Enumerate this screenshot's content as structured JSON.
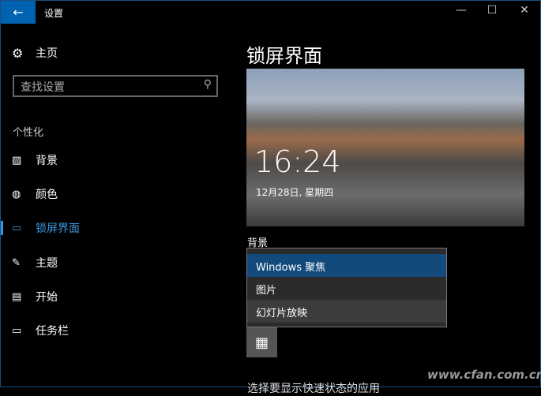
{
  "window": {
    "title": "设置",
    "back": "←",
    "minimize": "—",
    "maximize": "☐",
    "close": "✕"
  },
  "sidebar": {
    "home": "主页",
    "search_placeholder": "查找设置",
    "group": "个性化",
    "items": [
      {
        "label": "背景",
        "icon": "🖼"
      },
      {
        "label": "颜色",
        "icon": "🎨"
      },
      {
        "label": "锁屏界面",
        "icon": "▭"
      },
      {
        "label": "主题",
        "icon": "✎"
      },
      {
        "label": "开始",
        "icon": "▤"
      },
      {
        "label": "任务栏",
        "icon": "▭"
      }
    ]
  },
  "main": {
    "title": "锁屏界面",
    "preview_time": "16:24",
    "preview_date": "12月28日, 星期四",
    "background_label": "背景",
    "options": [
      "Windows 聚焦",
      "图片",
      "幻灯片放映"
    ],
    "below_text": "选择要显示快速状态的应用"
  },
  "watermark": "www.cfan.com.cn"
}
